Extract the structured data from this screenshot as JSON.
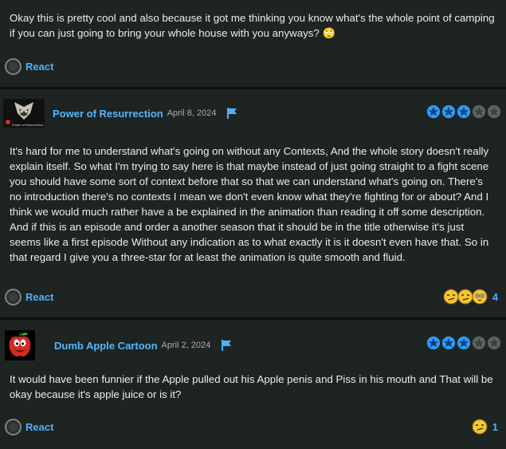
{
  "reviews": [
    {
      "text": "Okay this is pretty cool and also because it got me thinking you know what's the whole point of camping if you can just going to bring your whole house with you anyways? 🙄",
      "react_label": "React"
    },
    {
      "username": "Power of Resurrection",
      "date": "April 8, 2024",
      "avatar_caption": "Power of Resurrection",
      "rating": 3,
      "rating_max": 5,
      "text": "It's hard for me to understand what's going on without any Contexts, And the whole story doesn't really explain itself. So what I'm trying to say here is that maybe instead of just going straight to a fight scene you should have some sort of context before that so that we can understand what's going on. There's no introduction there's no contexts I mean we don't even know what they're fighting for or about? And I think we would much rather have a be explained in the animation than reading it off some description. And if this is an episode and order a another season that it should be in the title otherwise it's just seems like a first episode Without any indication as to what exactly it is it doesn't even have that. So in that regard I give you a three-star for at least the animation is quite smooth and fluid.",
      "react_label": "React",
      "reaction_count": "4",
      "reaction_icons": [
        "smirk-face-icon",
        "smirk-face-icon",
        "flushed-face-icon"
      ]
    },
    {
      "username": "Dumb Apple Cartoon",
      "date": "April 2, 2024",
      "rating": 3,
      "rating_max": 5,
      "text": "It would have been funnier if the Apple pulled out his Apple penis and Piss in his mouth and That will be okay because it's apple juice or is it?",
      "react_label": "React",
      "reaction_count": "1",
      "reaction_icons": [
        "smirk-face-icon"
      ]
    }
  ],
  "colors": {
    "background": "#1d2422",
    "link": "#56b6ff",
    "star_filled": "#2f9bff",
    "star_empty": "#5d6461"
  }
}
